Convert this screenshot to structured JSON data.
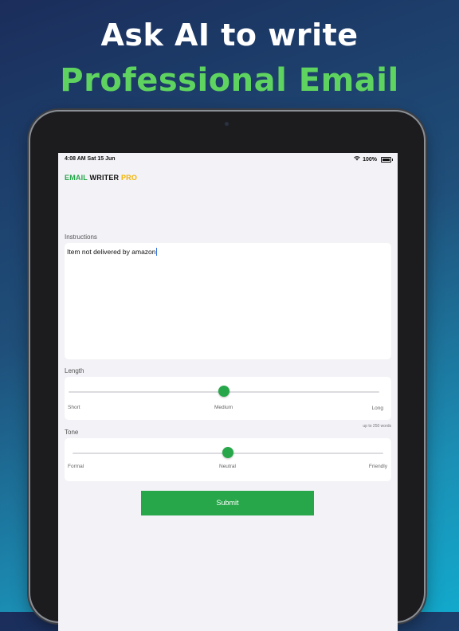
{
  "promo": {
    "line1": "Ask AI to write",
    "line2": "Professional Email"
  },
  "status_bar": {
    "time_date": "4:08 AM  Sat 15 Jun",
    "battery": "100%",
    "icons": [
      "wifi-icon",
      "battery-icon"
    ]
  },
  "brand": {
    "part1": "EMAIL",
    "part2": "WRITER",
    "part3": "PRO",
    "colors": {
      "email": "#27a74a",
      "writer": "#111111",
      "pro": "#f4b400"
    }
  },
  "instructions": {
    "label": "Instructions",
    "value": "Item not delivered by amazon"
  },
  "length": {
    "label": "Length",
    "options": [
      "Short",
      "Medium",
      "Long"
    ],
    "selected": "Medium",
    "hint": "up to 250 words"
  },
  "tone": {
    "label": "Tone",
    "options": [
      "Formal",
      "Neutral",
      "Friendly"
    ],
    "selected": "Neutral"
  },
  "submit": {
    "label": "Submit",
    "color": "#27a74a"
  }
}
